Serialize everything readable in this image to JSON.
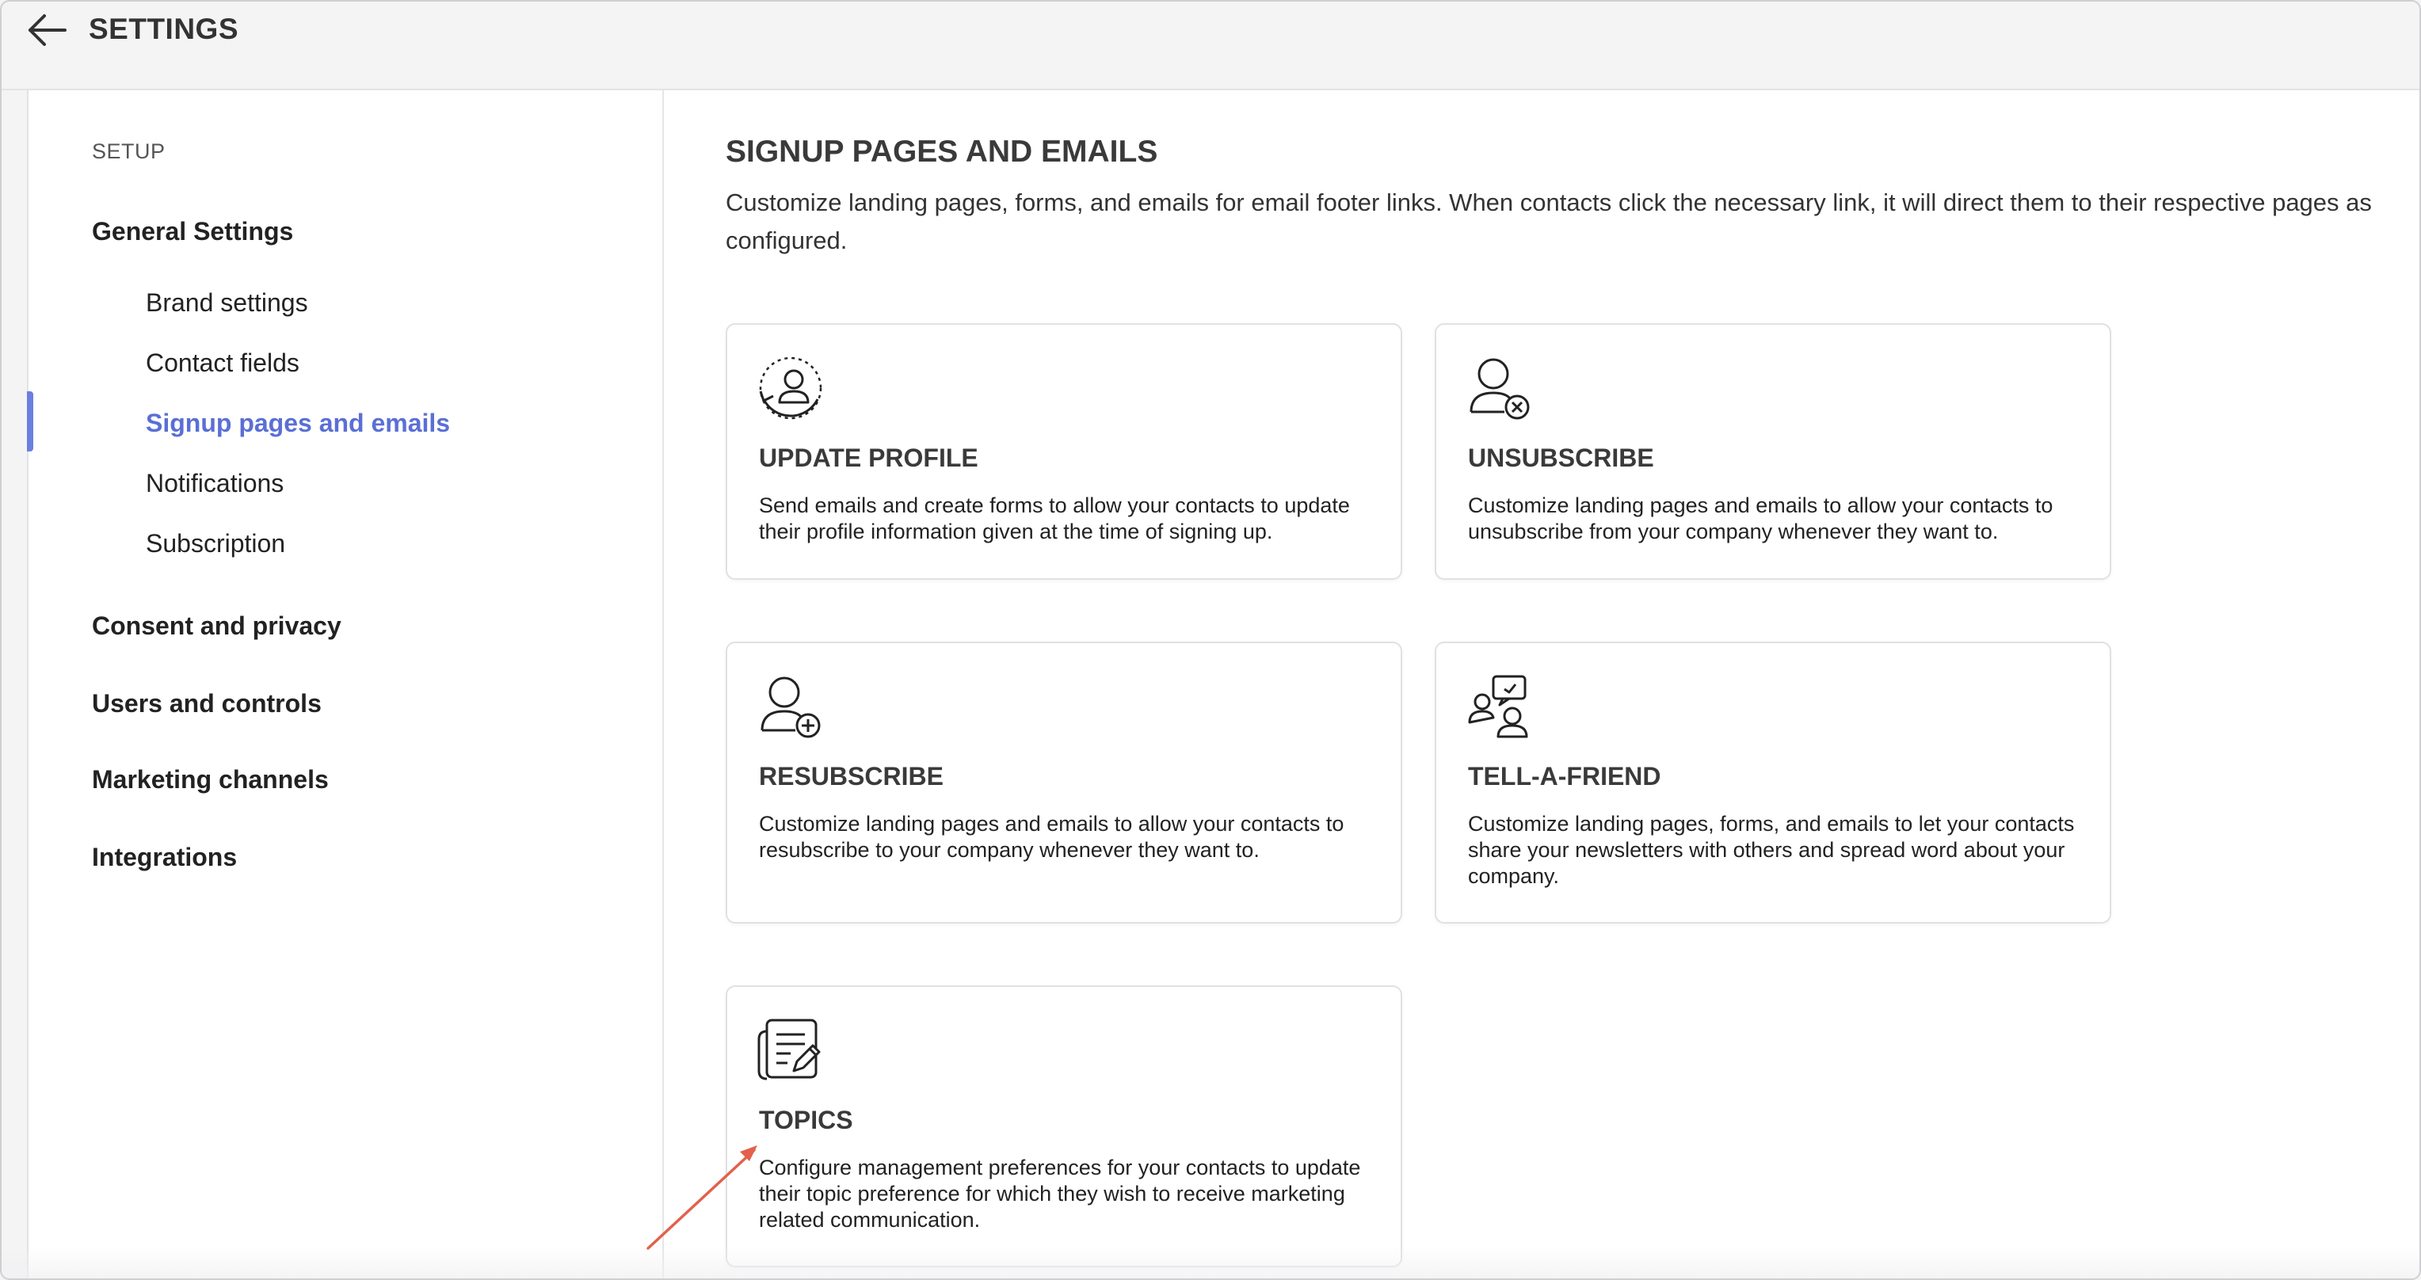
{
  "header": {
    "title": "SETTINGS",
    "back_icon": "arrow-left-icon"
  },
  "sidebar": {
    "section_label": "SETUP",
    "general_settings": {
      "label": "General Settings",
      "items": [
        {
          "label": "Brand settings",
          "active": false
        },
        {
          "label": "Contact fields",
          "active": false
        },
        {
          "label": "Signup pages and emails",
          "active": true
        },
        {
          "label": "Notifications",
          "active": false
        },
        {
          "label": "Subscription",
          "active": false
        }
      ]
    },
    "groups": [
      {
        "label": "Consent and privacy"
      },
      {
        "label": "Users and controls"
      },
      {
        "label": "Marketing channels"
      },
      {
        "label": "Integrations"
      }
    ],
    "active_color": "#5a6fd6"
  },
  "main": {
    "title": "SIGNUP PAGES AND EMAILS",
    "description": "Customize landing pages, forms, and emails for email footer links. When contacts click the necessary link, it will direct them to their respective pages as configured.",
    "cards": [
      {
        "icon": "update-profile-icon",
        "title": "UPDATE PROFILE",
        "description": "Send emails and create forms to allow your contacts to update their profile information given at the time of signing up."
      },
      {
        "icon": "unsubscribe-icon",
        "title": "UNSUBSCRIBE",
        "description": "Customize landing pages and emails to allow your contacts to unsubscribe from your company whenever they want to."
      },
      {
        "icon": "resubscribe-icon",
        "title": "RESUBSCRIBE",
        "description": "Customize landing pages and emails to allow your contacts to resubscribe to your company whenever they want to."
      },
      {
        "icon": "tell-a-friend-icon",
        "title": "TELL-A-FRIEND",
        "description": "Customize landing pages, forms, and emails to let your contacts share your newsletters with others and spread word about your company."
      },
      {
        "icon": "topics-icon",
        "title": "TOPICS",
        "description": "Configure management preferences for your contacts to update their topic preference for which they wish to receive marketing related communication."
      }
    ]
  },
  "annotation": {
    "arrow_color": "#e2614b"
  }
}
